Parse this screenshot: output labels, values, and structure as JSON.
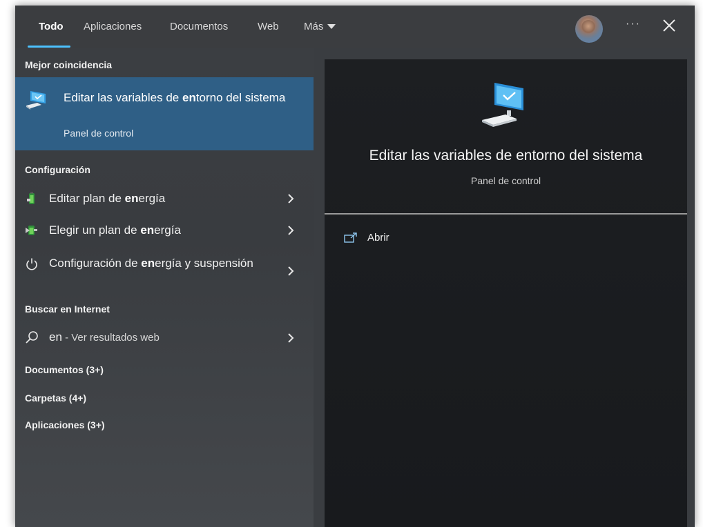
{
  "tabs": [
    {
      "label": "Todo"
    },
    {
      "label": "Aplicaciones"
    },
    {
      "label": "Documentos"
    },
    {
      "label": "Web"
    },
    {
      "label": "Más"
    }
  ],
  "topbar": {
    "more_icon": "ellipsis-icon",
    "close_icon": "close-icon",
    "avatar": "user-avatar"
  },
  "left": {
    "best_match_header": "Mejor coincidencia",
    "best_match": {
      "title": "Editar las variables de entorno del sistema",
      "title_parts": [
        "Editar las variables de ",
        "en",
        "torno del sistema"
      ],
      "subtitle": "Panel de control",
      "icon": "system-properties-icon"
    },
    "settings_header": "Configuración",
    "settings_items": [
      {
        "parts": [
          "Editar plan de ",
          "en",
          "ergía"
        ],
        "icon": "battery-icon"
      },
      {
        "parts": [
          "Elegir un plan de ",
          "en",
          "ergía"
        ],
        "icon": "power-plan-icon"
      },
      {
        "parts": [
          "Configuración de ",
          "en",
          "ergía y suspensión"
        ],
        "icon": "power-icon"
      }
    ],
    "internet_header": "Buscar en Internet",
    "web_search": {
      "query": "en",
      "hint": " - Ver resultados web",
      "icon": "search-icon"
    },
    "groups": [
      {
        "label": "Documentos (3+)"
      },
      {
        "label": "Carpetas (4+)"
      },
      {
        "label": "Aplicaciones (3+)"
      }
    ]
  },
  "right": {
    "title": "Editar las variables de entorno del sistema",
    "subtitle": "Panel de control",
    "actions": [
      {
        "label": "Abrir",
        "icon": "open-icon"
      }
    ]
  },
  "colors": {
    "accent": "#4cc2ff",
    "selection": "#2f5f86",
    "left_bg": "#3b3e42",
    "right_bg": "#1d1f22"
  }
}
